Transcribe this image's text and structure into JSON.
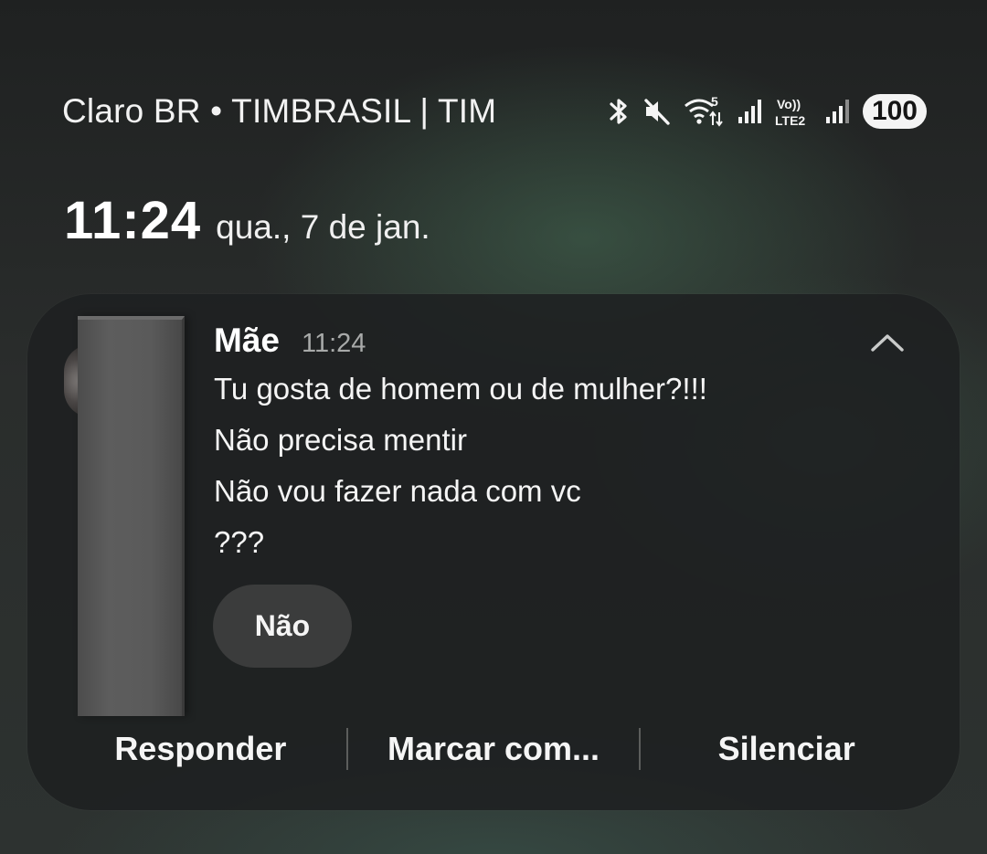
{
  "status_bar": {
    "carrier": "Claro BR • TIMBRASIL | TIM",
    "icons": [
      "bluetooth-icon",
      "mute-icon",
      "wifi-5-icon",
      "signal-icon",
      "volte-lte2-icon",
      "signal-icon"
    ],
    "wifi_band": "5",
    "volte_label": "Vo))",
    "lte_label": "LTE2",
    "battery": "100"
  },
  "lockscreen": {
    "time": "11:24",
    "date": "qua., 7 de jan."
  },
  "notification": {
    "sender": "Mãe",
    "time": "11:24",
    "messages": [
      "Tu gosta de homem ou de mulher?!!!",
      "Não precisa mentir",
      "Não vou fazer nada com vc",
      "???"
    ],
    "quick_reply": "Não",
    "actions": [
      "Responder",
      "Marcar com...",
      "Silenciar"
    ],
    "collapse_icon": "chevron-up-icon"
  },
  "colors": {
    "card_background": "#1e2021",
    "quick_reply_background": "#3b3c3c",
    "muted_text": "#a8aaa9",
    "battery_pill": "#f4f4f4"
  }
}
